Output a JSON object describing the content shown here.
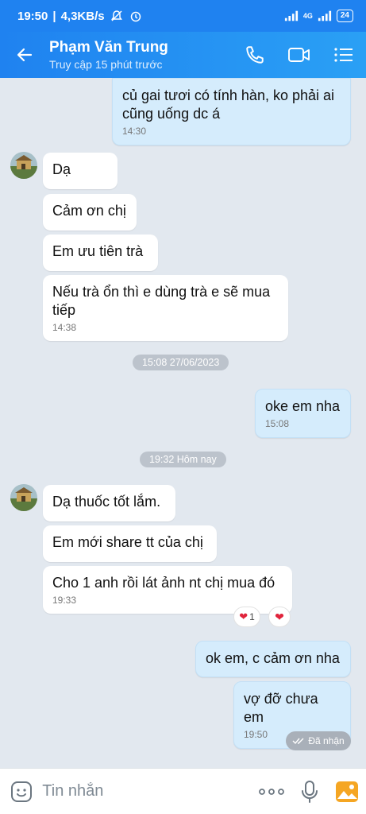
{
  "statusbar": {
    "time": "19:50",
    "speed": "4,3KB/s",
    "network": "4G",
    "battery": "24"
  },
  "header": {
    "contact_name": "Phạm Văn Trung",
    "last_seen": "Truy cập 15 phút trước"
  },
  "messages": [
    {
      "dir": "out",
      "text": "củ gai tươi có tính hàn, ko phải ai cũng uống dc á",
      "time": "14:30"
    },
    {
      "dir": "in",
      "text": "Dạ"
    },
    {
      "dir": "in",
      "text": "Cảm ơn chị"
    },
    {
      "dir": "in",
      "text": "Em ưu tiên trà"
    },
    {
      "dir": "in",
      "text": "Nếu trà ổn thì e dùng trà e sẽ mua tiếp",
      "time": "14:38"
    },
    {
      "dir": "out",
      "text": "oke em nha",
      "time": "15:08"
    },
    {
      "dir": "in",
      "text": "Dạ thuốc tốt lắm."
    },
    {
      "dir": "in",
      "text": "Em mới share tt của chị"
    },
    {
      "dir": "in",
      "text": "Cho 1 anh rồi lát ảnh nt chị mua đó",
      "time": "19:33"
    },
    {
      "dir": "out",
      "text": "ok em, c cảm ơn nha"
    },
    {
      "dir": "out",
      "text": "vợ đỡ chưa em",
      "time": "19:50"
    }
  ],
  "date_dividers": [
    "15:08 27/06/2023",
    "19:32 Hôm nay"
  ],
  "reactions": {
    "count": "1",
    "heart": "❤"
  },
  "status": {
    "received": "Đã nhận"
  },
  "input": {
    "placeholder": "Tin nhắn"
  },
  "colors": {
    "header": "#1f82f0",
    "outgoing_bubble": "#d5ecfc",
    "background": "#e2e8ef"
  },
  "icons": [
    "back-arrow-icon",
    "phone-icon",
    "video-call-icon",
    "menu-icon",
    "sticker-icon",
    "more-icon",
    "microphone-icon",
    "image-icon"
  ]
}
